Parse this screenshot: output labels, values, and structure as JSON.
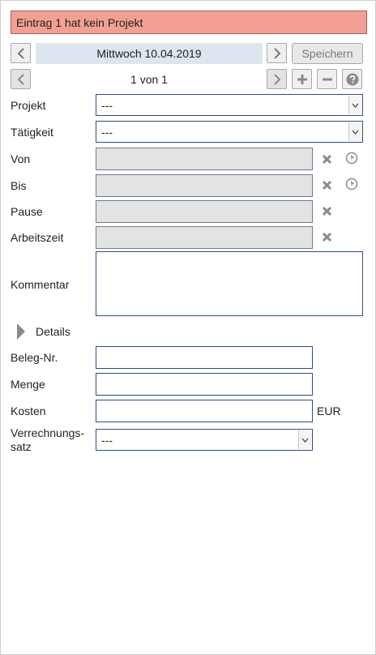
{
  "banner": {
    "message": "Eintrag 1 hat kein Projekt"
  },
  "header": {
    "date": "Mittwoch 10.04.2019",
    "save_label": "Speichern",
    "counter": "1 von 1"
  },
  "form": {
    "projekt": {
      "label": "Projekt",
      "value": "---"
    },
    "taetigkeit": {
      "label": "Tätigkeit",
      "value": "---"
    },
    "von": {
      "label": "Von",
      "value": ""
    },
    "bis": {
      "label": "Bis",
      "value": ""
    },
    "pause": {
      "label": "Pause",
      "value": ""
    },
    "arbeitszeit": {
      "label": "Arbeitszeit",
      "value": ""
    },
    "kommentar": {
      "label": "Kommentar",
      "value": ""
    }
  },
  "details": {
    "label": "Details",
    "beleg": {
      "label": "Beleg-Nr.",
      "value": ""
    },
    "menge": {
      "label": "Menge",
      "value": ""
    },
    "kosten": {
      "label": "Kosten",
      "value": "",
      "unit": "EUR"
    },
    "verrechnungssatz": {
      "label_line1": "Verrechnungs-",
      "label_line2": "satz",
      "value": "---"
    }
  },
  "icons": {
    "prev": "chevron-left-icon",
    "next": "chevron-right-icon",
    "add": "plus-icon",
    "remove": "minus-icon",
    "help": "question-icon",
    "clear": "close-icon",
    "time": "clock-icon",
    "expand": "triangle-right-icon"
  },
  "colors": {
    "banner_bg": "#f1a093",
    "date_bg": "#dde6ee",
    "field_border": "#2e4f82",
    "readonly_bg": "#e3e3e3",
    "icon_gray": "#8a8a8a"
  }
}
